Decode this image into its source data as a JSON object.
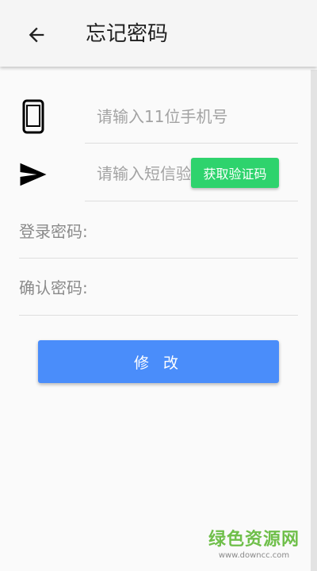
{
  "header": {
    "back_icon": "arrow-left-icon",
    "title": "忘记密码"
  },
  "form": {
    "phone": {
      "icon": "smartphone-icon",
      "placeholder": "请输入11位手机号",
      "value": ""
    },
    "sms_code": {
      "icon": "send-icon",
      "placeholder": "请输入短信验证码",
      "value": "",
      "get_code_label": "获取验证码"
    },
    "login_password": {
      "label": "登录密码:",
      "value": ""
    },
    "confirm_password": {
      "label": "确认密码:",
      "value": ""
    },
    "submit_label": "修 改"
  },
  "watermark": {
    "main": "绿色资源网",
    "url": "www.downcc.com"
  },
  "colors": {
    "get_code_button": "#2ed36d",
    "submit_button": "#4a8dfa",
    "watermark": "#6fbf4a"
  }
}
